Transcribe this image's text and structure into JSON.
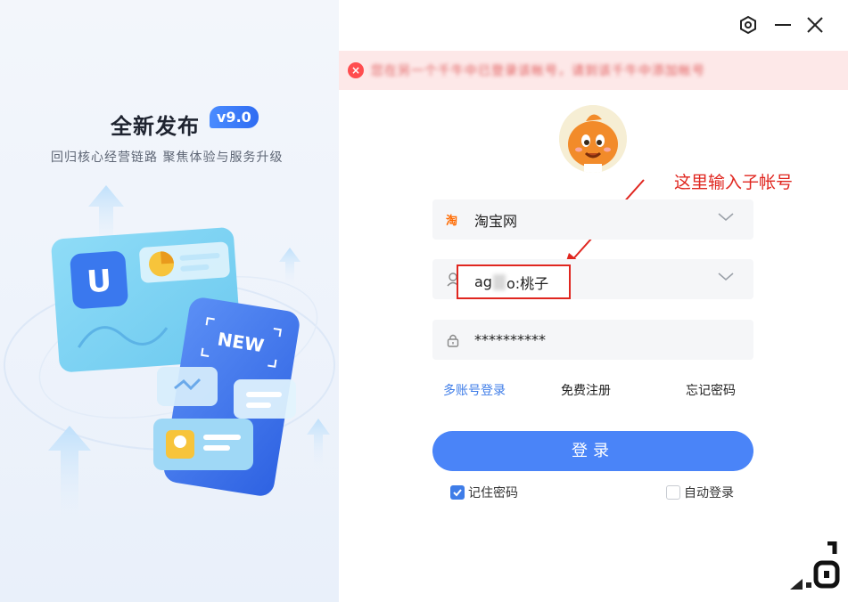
{
  "promo": {
    "title": "全新发布",
    "version": "v9.0",
    "subtitle": "回归核心经营链路 聚焦体验与服务升级",
    "card_tag": "NEW"
  },
  "window": {
    "settings_icon": "settings-hexagon-icon",
    "minimize_icon": "minimize-icon",
    "close_icon": "close-icon"
  },
  "error": {
    "message": "您在另一个千牛中已登录该帐号，请到该千牛中添加帐号"
  },
  "annotation": {
    "label": "这里输入子帐号"
  },
  "site_select": {
    "icon_text": "淘",
    "value": "淘宝网"
  },
  "account": {
    "prefix": "ag",
    "suffix": "o:桃子"
  },
  "password": {
    "value": "**********"
  },
  "links": {
    "multi_account": "多账号登录",
    "register": "免费注册",
    "forgot": "忘记密码"
  },
  "login_button": "登录",
  "options": {
    "remember_label": "记住密码",
    "remember_checked": true,
    "auto_login_label": "自动登录",
    "auto_login_checked": false
  },
  "colors": {
    "accent": "#4a84f8",
    "link": "#3f7de8",
    "error": "#ff4d4f",
    "annotation": "#e0261f"
  }
}
